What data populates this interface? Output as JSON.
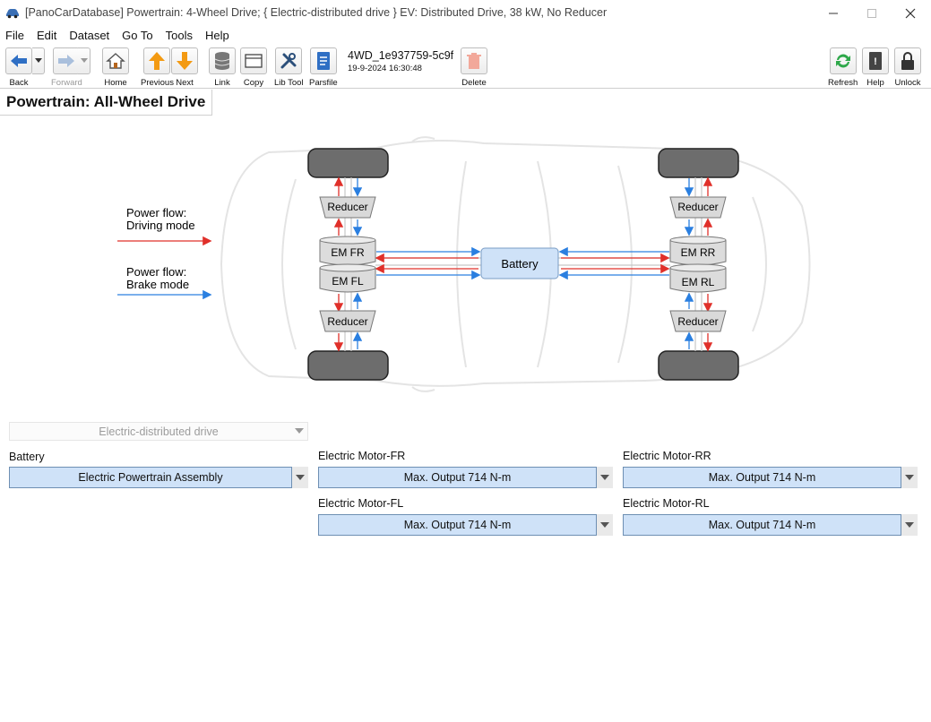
{
  "window": {
    "title": "[PanoCarDatabase] Powertrain: 4-Wheel Drive; { Electric-distributed drive } EV: Distributed Drive, 38 kW, No Reducer"
  },
  "menu": [
    "File",
    "Edit",
    "Dataset",
    "Go To",
    "Tools",
    "Help"
  ],
  "toolbar": {
    "back": "Back",
    "forward": "Forward",
    "home": "Home",
    "previous": "Previous",
    "next": "Next",
    "link": "Link",
    "copy": "Copy",
    "libtool": "Lib Tool",
    "parsfile": "Parsfile",
    "record_id": "4WD_1e937759-5c9f",
    "record_date": "19-9-2024 16:30:48",
    "delete": "Delete",
    "refresh": "Refresh",
    "help": "Help",
    "unlock": "Unlock"
  },
  "tab": {
    "title": "Powertrain: All-Wheel Drive"
  },
  "diagram": {
    "legend_driving_1": "Power flow:",
    "legend_driving_2": "Driving mode",
    "legend_brake_1": "Power flow:",
    "legend_brake_2": "Brake mode",
    "reducer": "Reducer",
    "em_fr": "EM FR",
    "em_fl": "EM FL",
    "em_rr": "EM RR",
    "em_rl": "EM RL",
    "battery": "Battery",
    "colors": {
      "driving": "#e0302a",
      "brake": "#2a7fe0",
      "battery_fill": "#cfe2f8",
      "tire": "#6d6d6d"
    }
  },
  "form": {
    "drive_type": "Electric-distributed drive",
    "battery_label": "Battery",
    "battery_value": "Electric Powertrain Assembly",
    "em_fr_label": "Electric Motor-FR",
    "em_fr_value": "Max. Output 714 N-m",
    "em_rr_label": "Electric Motor-RR",
    "em_rr_value": "Max. Output 714 N-m",
    "em_fl_label": "Electric Motor-FL",
    "em_fl_value": "Max. Output 714 N-m",
    "em_rl_label": "Electric Motor-RL",
    "em_rl_value": "Max. Output 714 N-m"
  }
}
